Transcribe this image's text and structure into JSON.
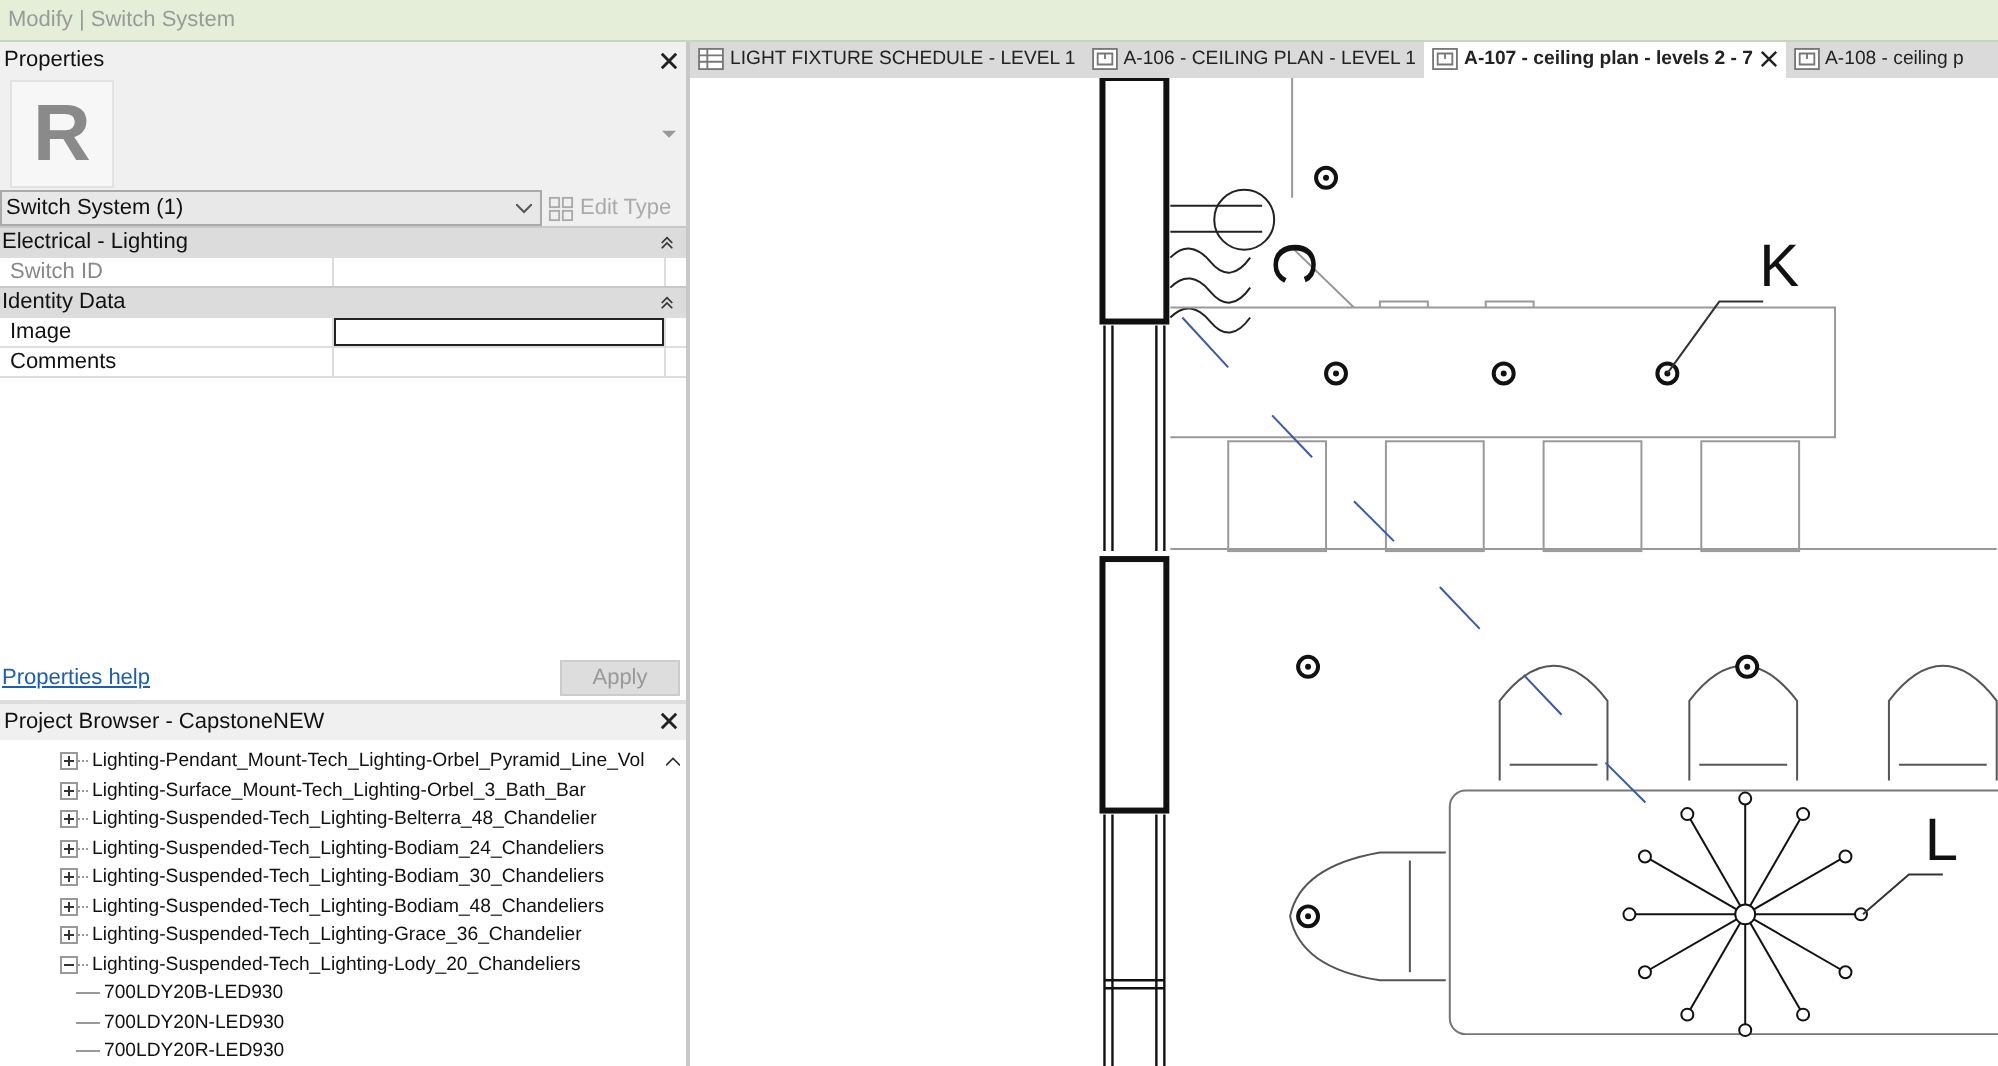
{
  "title_bar": {
    "text": "Modify | Switch System"
  },
  "properties": {
    "title": "Properties",
    "type_image": {
      "letter": "R"
    },
    "type_selector": {
      "value": "Switch System (1)"
    },
    "edit_type": {
      "label": "Edit Type",
      "disabled": true
    },
    "groups": [
      {
        "name": "Electrical - Lighting",
        "expanded": true,
        "rows": [
          {
            "label": "Switch ID",
            "value": "",
            "readonly": true,
            "selected": false
          }
        ]
      },
      {
        "name": "Identity Data",
        "expanded": true,
        "rows": [
          {
            "label": "Image",
            "value": "",
            "readonly": false,
            "selected": true
          },
          {
            "label": "Comments",
            "value": "",
            "readonly": false,
            "selected": false
          }
        ]
      }
    ],
    "help_link": "Properties help",
    "apply": {
      "label": "Apply",
      "disabled": true
    }
  },
  "project_browser": {
    "title": "Project Browser - CapstoneNEW",
    "items": [
      {
        "label": "Lighting-Pendant_Mount-Tech_Lighting-Orbel_Pyramid_Line_Vol",
        "expanded": false
      },
      {
        "label": "Lighting-Surface_Mount-Tech_Lighting-Orbel_3_Bath_Bar",
        "expanded": false
      },
      {
        "label": "Lighting-Suspended-Tech_Lighting-Belterra_48_Chandelier",
        "expanded": false
      },
      {
        "label": "Lighting-Suspended-Tech_Lighting-Bodiam_24_Chandeliers",
        "expanded": false
      },
      {
        "label": "Lighting-Suspended-Tech_Lighting-Bodiam_30_Chandeliers",
        "expanded": false
      },
      {
        "label": "Lighting-Suspended-Tech_Lighting-Bodiam_48_Chandeliers",
        "expanded": false
      },
      {
        "label": "Lighting-Suspended-Tech_Lighting-Grace_36_Chandelier",
        "expanded": false
      },
      {
        "label": "Lighting-Suspended-Tech_Lighting-Lody_20_Chandeliers",
        "expanded": true,
        "children": [
          {
            "label": "700LDY20B-LED930"
          },
          {
            "label": "700LDY20N-LED930"
          },
          {
            "label": "700LDY20R-LED930"
          }
        ]
      }
    ]
  },
  "tabs": [
    {
      "label": "LIGHT FIXTURE SCHEDULE - LEVEL 1",
      "kind": "schedule",
      "selected": false
    },
    {
      "label": "A-106 - CEILING PLAN - LEVEL 1",
      "kind": "plan",
      "selected": false
    },
    {
      "label": "A-107 - ceiling plan - levels 2 - 7",
      "kind": "plan",
      "selected": true
    },
    {
      "label": "A-108 - ceiling p",
      "kind": "plan",
      "selected": false
    }
  ],
  "plan": {
    "tags": [
      {
        "text": "C"
      },
      {
        "text": "K"
      },
      {
        "text": "L"
      }
    ]
  }
}
